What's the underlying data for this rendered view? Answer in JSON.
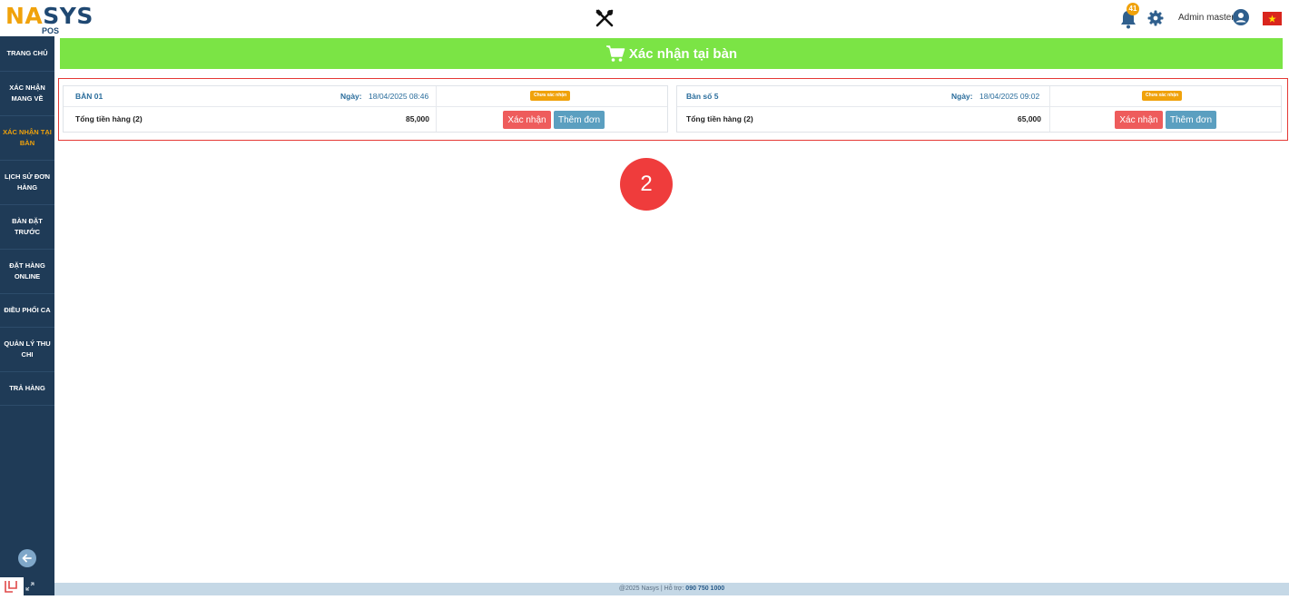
{
  "header": {
    "logo_na": "NA",
    "logo_sys": "SYS",
    "logo_pos": "POS",
    "notification_count": "41",
    "user_name": "Admin master"
  },
  "sidebar": {
    "items": [
      {
        "label": "TRANG CHỦ"
      },
      {
        "label": "XÁC NHẬN MANG VỀ"
      },
      {
        "label": "XÁC NHẬN TẠI BÀN"
      },
      {
        "label": "LỊCH SỬ ĐƠN HÀNG"
      },
      {
        "label": "BÀN ĐẶT TRƯỚC"
      },
      {
        "label": "ĐẶT HÀNG ONLINE"
      },
      {
        "label": "ĐIỀU PHỐI CA"
      },
      {
        "label": "QUẢN LÝ THU CHI"
      },
      {
        "label": "TRẢ HÀNG"
      }
    ],
    "active_index": 2
  },
  "page": {
    "title": "Xác nhận tại bàn"
  },
  "orders": [
    {
      "table": "BÀN 01",
      "date_label": "Ngày:",
      "date": "18/04/2025 08:46",
      "status": "Chưa xác nhận",
      "total_label": "Tổng tiền hàng (2)",
      "total": "85,000",
      "confirm_label": "Xác nhận",
      "add_label": "Thêm đơn"
    },
    {
      "table": "Bàn số 5",
      "date_label": "Ngày:",
      "date": "18/04/2025 09:02",
      "status": "Chưa xác nhận",
      "total_label": "Tổng tiền hàng (2)",
      "total": "65,000",
      "confirm_label": "Xác nhận",
      "add_label": "Thêm đơn"
    }
  ],
  "step_marker": "2",
  "footer": {
    "text": "@2025 Nasys | Hỗ trợ:",
    "phone": "090 750 1000"
  },
  "colors": {
    "sidebar": "#1f3b57",
    "accent": "#f0a20b",
    "title_bar": "#7be445",
    "confirm": "#ee5c5c",
    "add": "#5b9fc0"
  }
}
